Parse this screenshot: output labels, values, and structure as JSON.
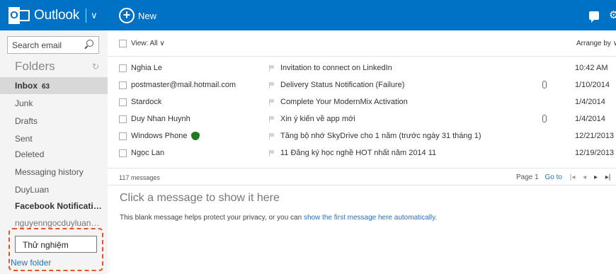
{
  "header": {
    "app_name": "Outlook",
    "logo_letter": "O",
    "caret": "∨",
    "new_symbol": "+",
    "new_label": "New",
    "gear": "⚙",
    "colors": {
      "brand": "#0072c6",
      "link": "#2372c4",
      "highlight_box": "#e2552b"
    }
  },
  "sidebar": {
    "search_placeholder": "Search email",
    "folders_title": "Folders",
    "refresh_glyph": "↻",
    "inbox_label": "Inbox",
    "inbox_count": "63",
    "folders": [
      {
        "label": "Junk"
      },
      {
        "label": "Drafts"
      },
      {
        "label": "Sent"
      },
      {
        "label": "Deleted"
      },
      {
        "label": "Messaging history"
      },
      {
        "label": "DuyLuan"
      },
      {
        "label": "Facebook Notificatio..."
      },
      {
        "label": "nguyenngocduyluan@..."
      }
    ],
    "rename_input_value": "Thử nghiệm",
    "new_folder_label": "New folder"
  },
  "list": {
    "view_label": "View: All ∨",
    "arrange_label": "Arrange by ∨",
    "messages": [
      {
        "sender": "Nghia Le",
        "subject": "Invitation to connect on LinkedIn",
        "date": "10:42 AM"
      },
      {
        "sender": "postmaster@mail.hotmail.com",
        "subject": "Delivery Status Notification (Failure)",
        "date": "1/10/2014"
      },
      {
        "sender": "Stardock",
        "subject": "Complete Your ModernMix Activation",
        "date": "1/4/2014"
      },
      {
        "sender": "Duy Nhan Huynh",
        "subject": "Xin ý kiến về app mới",
        "date": "1/4/2014"
      },
      {
        "sender": "Windows Phone",
        "subject": "Tăng bộ nhớ SkyDrive cho 1 năm (trước ngày 31 tháng 1)",
        "date": "12/21/2013"
      },
      {
        "sender": "Ngọc Lan",
        "subject": "11 Đăng ký học nghề HOT nhất năm 2014 11",
        "date": "12/19/2013"
      }
    ],
    "message_count": "117 messages",
    "page_label": "Page 1",
    "goto_label": "Go to",
    "nav_first": "|◂",
    "nav_prev": "◂",
    "nav_next": "▸",
    "nav_last": "▸|"
  },
  "reading": {
    "title": "Click a message to show it here",
    "text": "This blank message helps protect your privacy, or you can ",
    "link": "show the first message here automatically."
  }
}
